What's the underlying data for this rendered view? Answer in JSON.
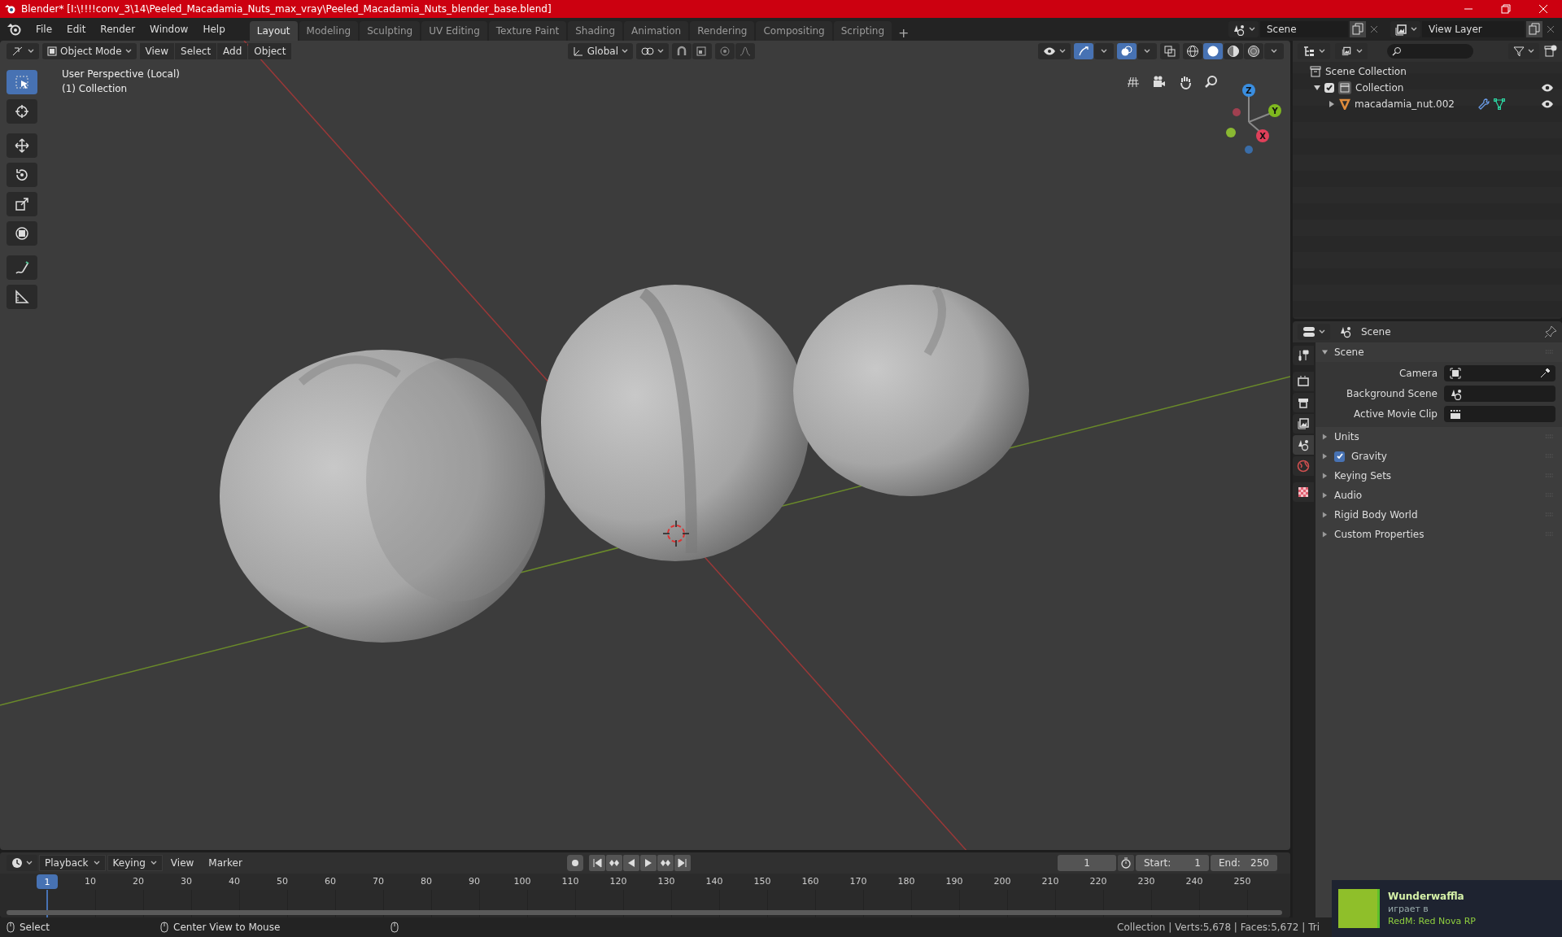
{
  "window": {
    "title": "Blender* [I:\\!!!!conv_3\\14\\Peeled_Macadamia_Nuts_max_vray\\Peeled_Macadamia_Nuts_blender_base.blend]"
  },
  "menu": [
    "File",
    "Edit",
    "Render",
    "Window",
    "Help"
  ],
  "workspaces": [
    {
      "label": "Layout",
      "selected": true
    },
    {
      "label": "Modeling",
      "selected": false
    },
    {
      "label": "Sculpting",
      "selected": false
    },
    {
      "label": "UV Editing",
      "selected": false
    },
    {
      "label": "Texture Paint",
      "selected": false
    },
    {
      "label": "Shading",
      "selected": false
    },
    {
      "label": "Animation",
      "selected": false
    },
    {
      "label": "Rendering",
      "selected": false
    },
    {
      "label": "Compositing",
      "selected": false
    },
    {
      "label": "Scripting",
      "selected": false
    }
  ],
  "add_workspace": "+",
  "scene_selector": "Scene",
  "view_layer": "View Layer",
  "viewport_header": {
    "mode": "Object Mode",
    "menus": [
      "View",
      "Select",
      "Add",
      "Object"
    ],
    "orientation": "Global"
  },
  "shading": [
    {
      "kind": "wireframe",
      "selected": false
    },
    {
      "kind": "solid",
      "selected": true
    },
    {
      "kind": "material",
      "selected": false
    },
    {
      "kind": "rendered",
      "selected": false
    }
  ],
  "tools": [
    {
      "kind": "select",
      "selected": true
    },
    {
      "kind": "cursor",
      "selected": false
    },
    {
      "kind": "move",
      "selected": false
    },
    {
      "kind": "rotate",
      "selected": false
    },
    {
      "kind": "scale",
      "selected": false
    },
    {
      "kind": "transform",
      "selected": false
    },
    {
      "kind": "annotate",
      "selected": false
    },
    {
      "kind": "measure",
      "selected": false
    }
  ],
  "viewport": {
    "info": [
      "User Perspective (Local)",
      "(1) Collection"
    ],
    "gizmo": [
      "Z",
      "Y",
      "X"
    ]
  },
  "outliner": {
    "items": [
      {
        "label": "Scene Collection",
        "kind": "scene_collection",
        "children": [
          {
            "label": "Collection",
            "kind": "collection",
            "checked": true,
            "children": [
              {
                "label": "macadamia_nut.002",
                "kind": "mesh_object"
              }
            ]
          }
        ]
      }
    ]
  },
  "properties": {
    "header": "Scene",
    "tabs": [
      {
        "kind": "tool",
        "selected": false
      },
      {
        "kind": "render",
        "selected": false
      },
      {
        "kind": "output",
        "selected": false
      },
      {
        "kind": "view_layer",
        "selected": false
      },
      {
        "kind": "scene",
        "selected": true
      },
      {
        "kind": "world",
        "selected": false
      },
      {
        "kind": "texture",
        "selected": false
      }
    ],
    "panel": {
      "title": "Scene",
      "expanded": true,
      "fields": [
        {
          "label": "Camera",
          "kind": "camera"
        },
        {
          "label": "Background Scene",
          "kind": "scene"
        },
        {
          "label": "Active Movie Clip",
          "kind": "clip"
        }
      ]
    },
    "sections": [
      {
        "label": "Units"
      },
      {
        "label": "Gravity",
        "checked": true
      },
      {
        "label": "Keying Sets"
      },
      {
        "label": "Audio"
      },
      {
        "label": "Rigid Body World"
      },
      {
        "label": "Custom Properties"
      }
    ]
  },
  "timeline": {
    "menus": [
      "Playback",
      "Keying"
    ],
    "plain_menus": [
      "View",
      "Marker"
    ],
    "current_frame": "1",
    "start_label": "Start:",
    "start": "1",
    "end_label": "End:",
    "end": "250",
    "playhead": "1",
    "ruler": [
      "10",
      "20",
      "30",
      "40",
      "50",
      "60",
      "70",
      "80",
      "90",
      "100",
      "110",
      "120",
      "130",
      "140",
      "150",
      "160",
      "170",
      "180",
      "190",
      "200",
      "210",
      "220",
      "230",
      "240",
      "250"
    ]
  },
  "status_bar": {
    "hints": [
      "Select",
      "Center View to Mouse"
    ],
    "stats": "Collection | Verts:5,678 | Faces:5,672 | Tri"
  },
  "notification": {
    "name": "Wunderwaffla",
    "status": "играет в",
    "game": "RedM: Red Nova RP"
  }
}
